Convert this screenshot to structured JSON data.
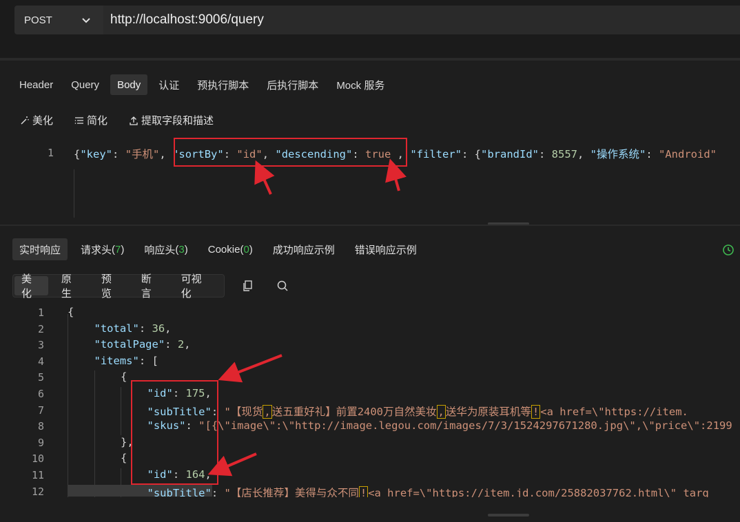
{
  "request": {
    "method": "POST",
    "url": "http://localhost:9006/query"
  },
  "req_tabs": [
    "Header",
    "Query",
    "Body",
    "认证",
    "预执行脚本",
    "后执行脚本",
    "Mock 服务"
  ],
  "req_active_tab": "Body",
  "body_tools": {
    "beautify": "美化",
    "simplify": "简化",
    "extract": "提取字段和描述"
  },
  "request_body": {
    "line_number": "1",
    "tokens": [
      {
        "t": "{",
        "c": "p"
      },
      {
        "t": "\"key\"",
        "c": "k"
      },
      {
        "t": ": ",
        "c": "p"
      },
      {
        "t": "\"手机\"",
        "c": "s"
      },
      {
        "t": ", ",
        "c": "p"
      },
      {
        "t": "\"sortBy\"",
        "c": "k"
      },
      {
        "t": ": ",
        "c": "p"
      },
      {
        "t": "\"id\"",
        "c": "s"
      },
      {
        "t": ", ",
        "c": "p"
      },
      {
        "t": "\"descending\"",
        "c": "k"
      },
      {
        "t": ": ",
        "c": "p"
      },
      {
        "t": "true",
        "c": "s"
      },
      {
        "t": " , ",
        "c": "p"
      },
      {
        "t": "\"filter\"",
        "c": "k"
      },
      {
        "t": ": {",
        "c": "p"
      },
      {
        "t": "\"brandId\"",
        "c": "k"
      },
      {
        "t": ": ",
        "c": "p"
      },
      {
        "t": "8557",
        "c": "n"
      },
      {
        "t": ", ",
        "c": "p"
      },
      {
        "t": "\"操作系统\"",
        "c": "k"
      },
      {
        "t": ": ",
        "c": "p"
      },
      {
        "t": "\"Android\"",
        "c": "s"
      }
    ]
  },
  "resp_tabs": [
    {
      "label": "实时响应",
      "count": ""
    },
    {
      "label": "请求头",
      "count": "7"
    },
    {
      "label": "响应头",
      "count": "3"
    },
    {
      "label": "Cookie",
      "count": "0"
    },
    {
      "label": "成功响应示例",
      "count": ""
    },
    {
      "label": "错误响应示例",
      "count": ""
    }
  ],
  "view_tabs": [
    "美化",
    "原生",
    "预览",
    "断言",
    "可视化"
  ],
  "response_lines": [
    {
      "n": "1",
      "indent": 0,
      "tokens": [
        {
          "t": "{",
          "c": "p"
        }
      ]
    },
    {
      "n": "2",
      "indent": 1,
      "tokens": [
        {
          "t": "\"total\"",
          "c": "k"
        },
        {
          "t": ": ",
          "c": "p"
        },
        {
          "t": "36",
          "c": "n"
        },
        {
          "t": ",",
          "c": "p"
        }
      ]
    },
    {
      "n": "3",
      "indent": 1,
      "tokens": [
        {
          "t": "\"totalPage\"",
          "c": "k"
        },
        {
          "t": ": ",
          "c": "p"
        },
        {
          "t": "2",
          "c": "n"
        },
        {
          "t": ",",
          "c": "p"
        }
      ]
    },
    {
      "n": "4",
      "indent": 1,
      "tokens": [
        {
          "t": "\"items\"",
          "c": "k"
        },
        {
          "t": ": [",
          "c": "p"
        }
      ]
    },
    {
      "n": "5",
      "indent": 2,
      "tokens": [
        {
          "t": "{",
          "c": "p"
        }
      ]
    },
    {
      "n": "6",
      "indent": 3,
      "tokens": [
        {
          "t": "\"id\"",
          "c": "k"
        },
        {
          "t": ": ",
          "c": "p"
        },
        {
          "t": "175",
          "c": "n"
        },
        {
          "t": ",",
          "c": "p"
        }
      ]
    },
    {
      "n": "7",
      "indent": 3,
      "tokens": [
        {
          "t": "\"subTitle\"",
          "c": "k"
        },
        {
          "t": ": ",
          "c": "p"
        },
        {
          "t": "\"【现货",
          "c": "s"
        },
        {
          "t": ",",
          "c": "s",
          "box": true
        },
        {
          "t": "送五重好礼】前置2400万自然美妆",
          "c": "s"
        },
        {
          "t": ",",
          "c": "s",
          "box": true
        },
        {
          "t": "送华为原装耳机等",
          "c": "s"
        },
        {
          "t": "!",
          "c": "s",
          "box": true
        },
        {
          "t": "<a href=\\\"https://item.",
          "c": "s"
        }
      ]
    },
    {
      "n": "8",
      "indent": 3,
      "tokens": [
        {
          "t": "\"skus\"",
          "c": "k"
        },
        {
          "t": ": ",
          "c": "p"
        },
        {
          "t": "\"[{\\\"image\\\":\\\"http://image.legou.com/images/7/3/1524297671280.jpg\\\",\\\"price\\\":2199",
          "c": "s"
        }
      ]
    },
    {
      "n": "9",
      "indent": 2,
      "tokens": [
        {
          "t": "},",
          "c": "p"
        }
      ]
    },
    {
      "n": "10",
      "indent": 2,
      "tokens": [
        {
          "t": "{",
          "c": "p"
        }
      ]
    },
    {
      "n": "11",
      "indent": 3,
      "tokens": [
        {
          "t": "\"id\"",
          "c": "k"
        },
        {
          "t": ": ",
          "c": "p"
        },
        {
          "t": "164",
          "c": "n"
        },
        {
          "t": ",",
          "c": "p"
        }
      ]
    },
    {
      "n": "12",
      "indent": 3,
      "tokens": [
        {
          "t": "\"subTitle\"",
          "c": "k"
        },
        {
          "t": ": ",
          "c": "p"
        },
        {
          "t": "\"【店长推荐】美得与众不同",
          "c": "s"
        },
        {
          "t": "!",
          "c": "s",
          "box": true
        },
        {
          "t": "<a href=\\\"https://item.jd.com/25882037762.html\\\" targ",
          "c": "s"
        }
      ]
    }
  ]
}
